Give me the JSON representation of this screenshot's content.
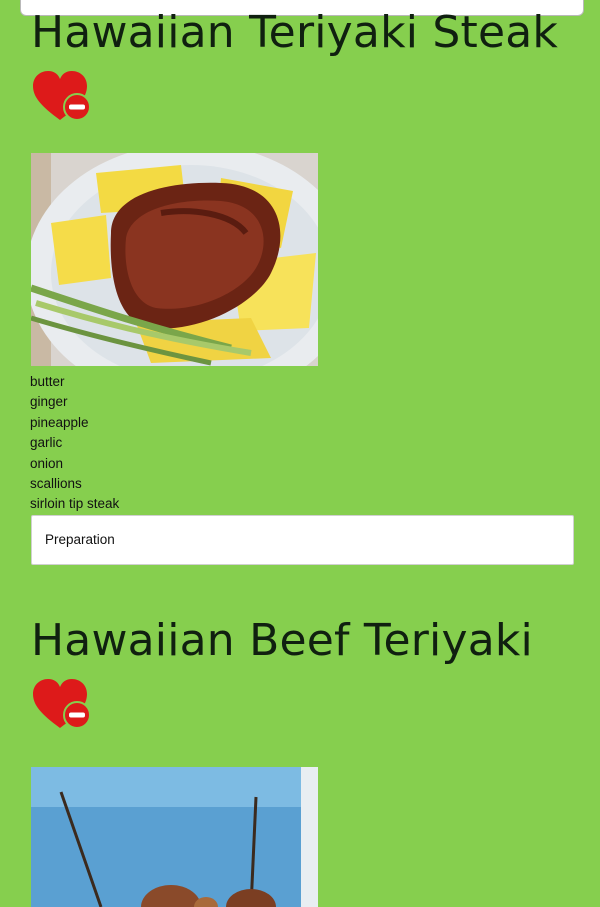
{
  "colors": {
    "page_background": "#86cf4e",
    "heart": "#dd1a1a",
    "title": "#102010"
  },
  "recipes": [
    {
      "title": "Hawaiian Teriyaki Steak",
      "favorite_icon": "heart-minus-icon",
      "ingredients": [
        "butter",
        "ginger",
        "pineapple",
        "garlic",
        "onion",
        "scallions",
        "sirloin tip steak"
      ],
      "preparation_label": "Preparation"
    },
    {
      "title": "Hawaiian Beef Teriyaki",
      "favorite_icon": "heart-minus-icon"
    }
  ]
}
